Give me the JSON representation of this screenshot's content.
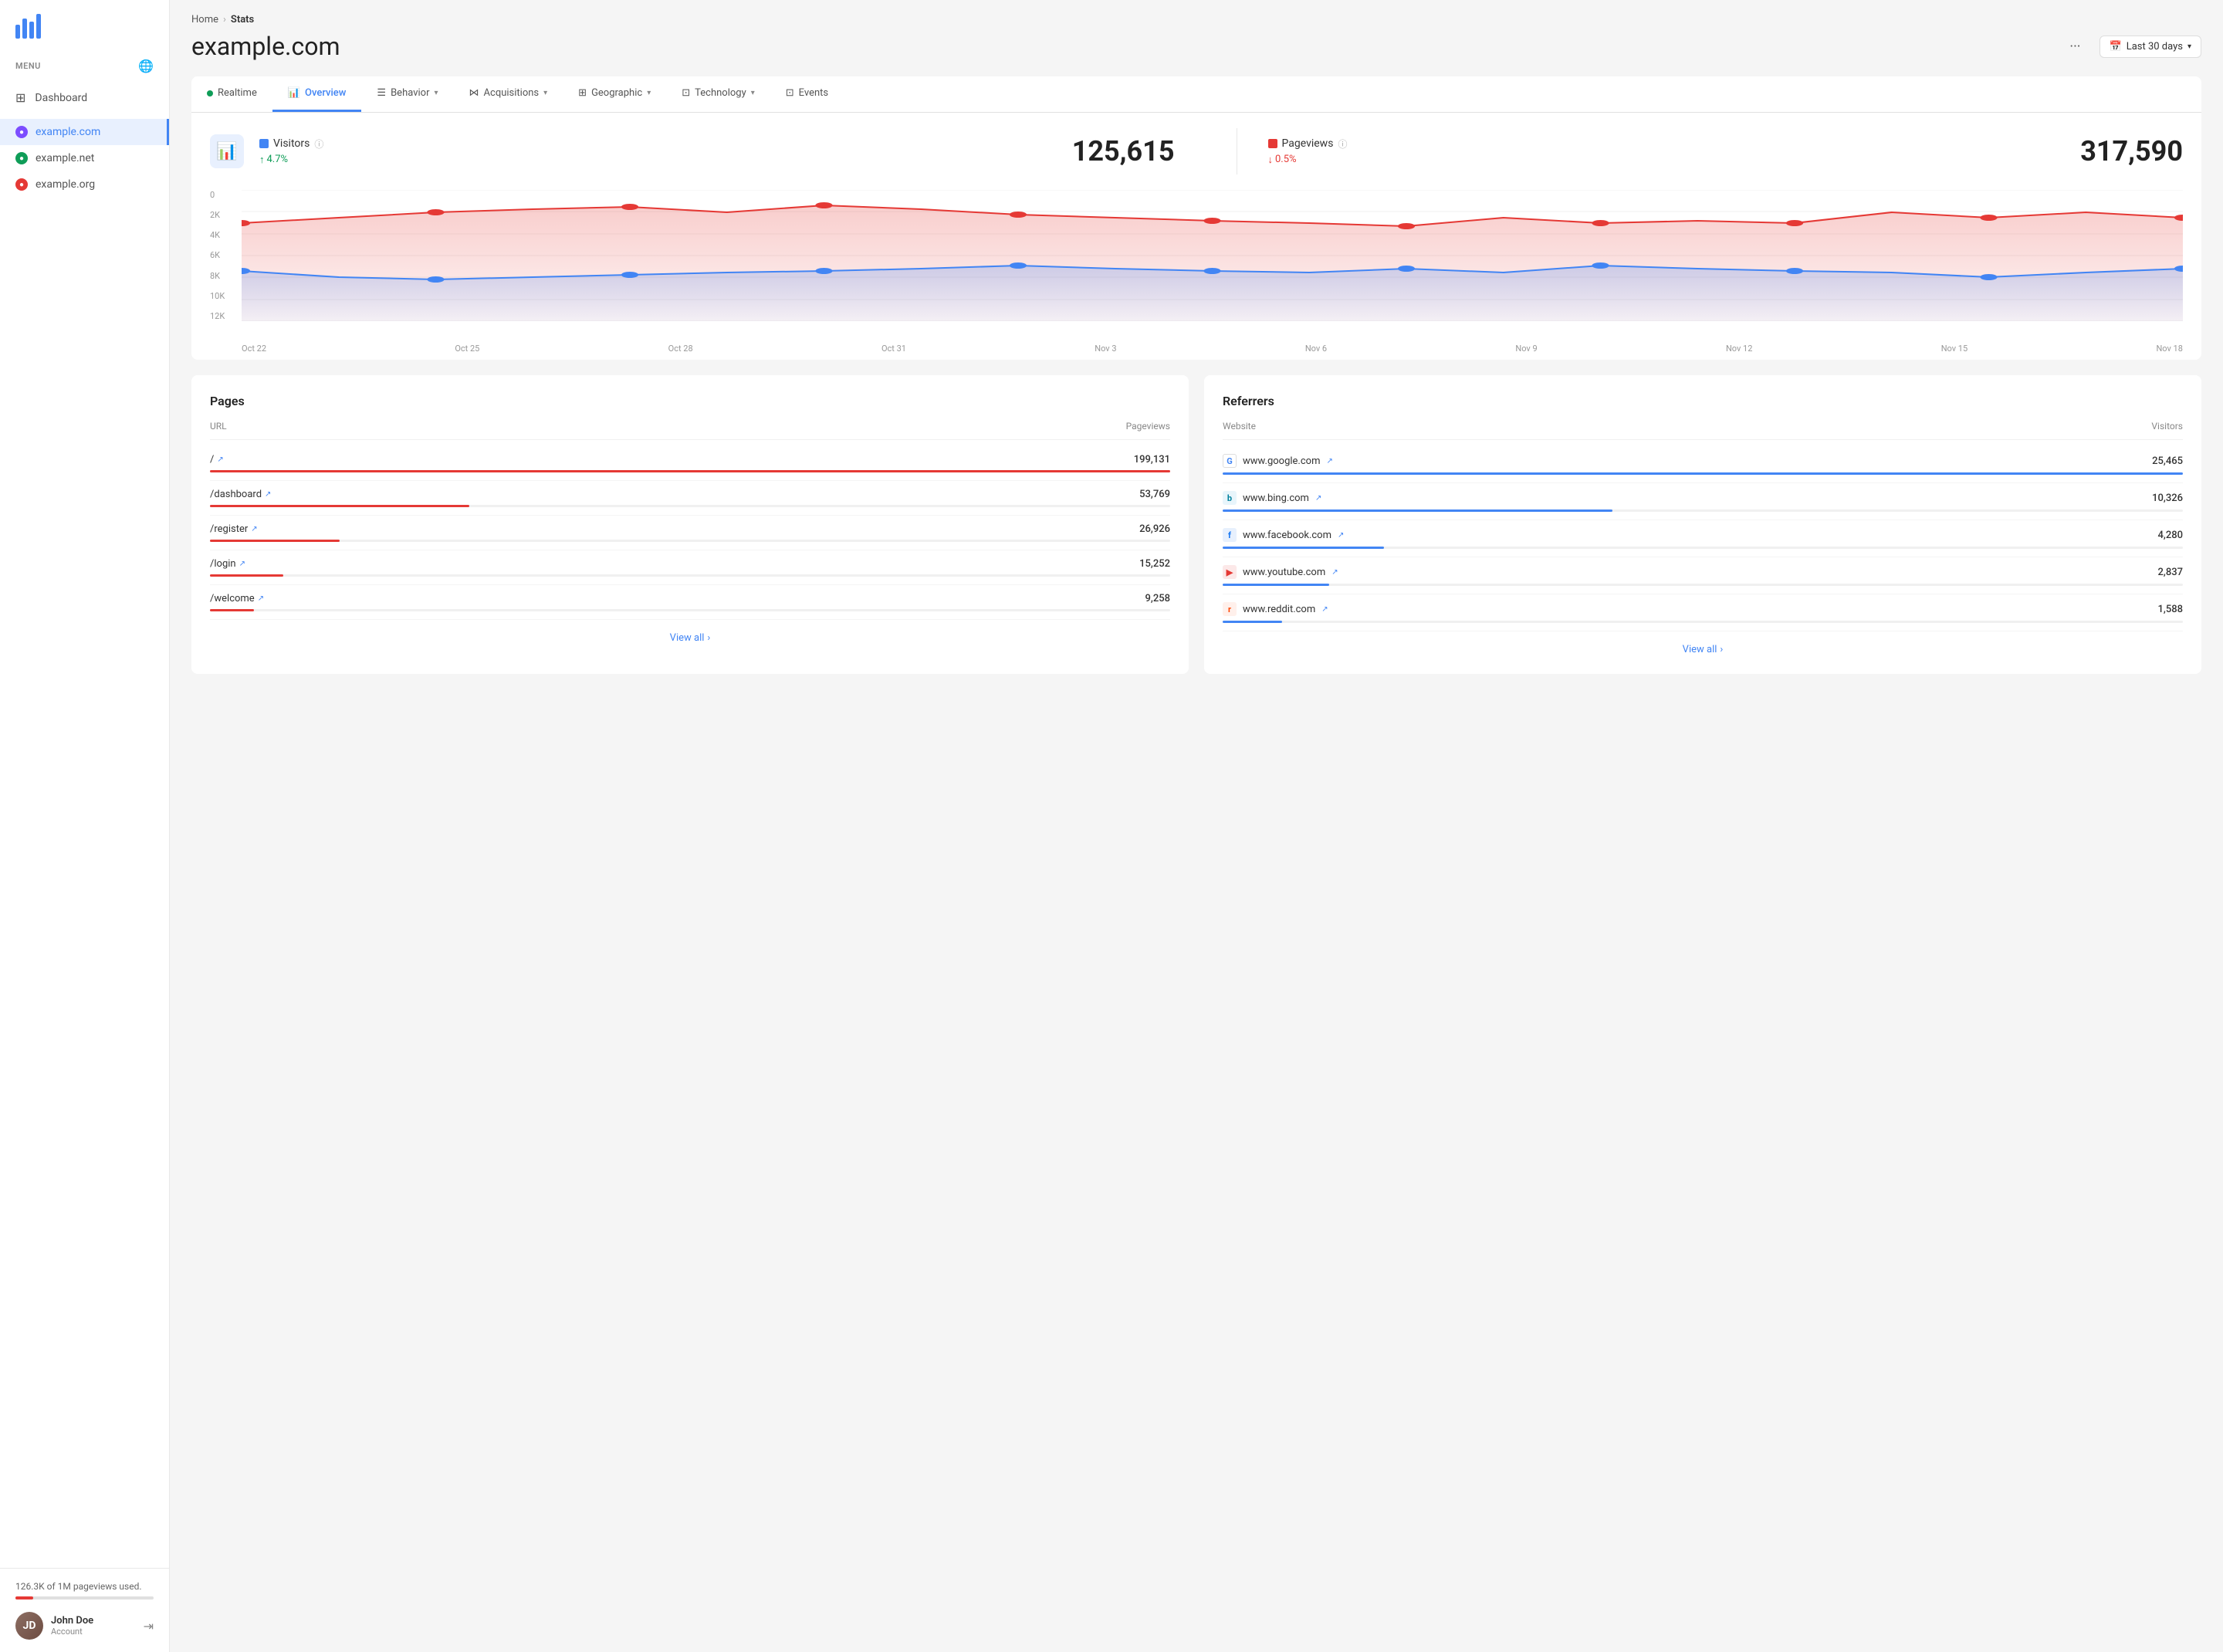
{
  "sidebar": {
    "menu_label": "MENU",
    "nav_items": [
      {
        "id": "dashboard",
        "label": "Dashboard",
        "icon": "⊞"
      }
    ],
    "sites": [
      {
        "id": "example-com",
        "label": "example.com",
        "color": "#7c4dff",
        "active": true
      },
      {
        "id": "example-net",
        "label": "example.net",
        "color": "#0f9d58",
        "active": false
      },
      {
        "id": "example-org",
        "label": "example.org",
        "color": "#e53935",
        "active": false
      }
    ],
    "usage_text": "126.3K of 1M pageviews used.",
    "usage_pct": 12.63,
    "user": {
      "name": "John Doe",
      "sub": "Account"
    }
  },
  "header": {
    "breadcrumb_home": "Home",
    "breadcrumb_current": "Stats",
    "title": "example.com",
    "more_icon": "···",
    "date_icon": "📅",
    "date_label": "Last 30 days"
  },
  "tabs": [
    {
      "id": "realtime",
      "label": "Realtime",
      "type": "dot"
    },
    {
      "id": "overview",
      "label": "Overview",
      "type": "icon",
      "active": true
    },
    {
      "id": "behavior",
      "label": "Behavior",
      "type": "chevron"
    },
    {
      "id": "acquisitions",
      "label": "Acquisitions",
      "type": "chevron"
    },
    {
      "id": "geographic",
      "label": "Geographic",
      "type": "chevron"
    },
    {
      "id": "technology",
      "label": "Technology",
      "type": "chevron"
    },
    {
      "id": "events",
      "label": "Events",
      "type": "icon"
    }
  ],
  "stats": {
    "visitors_label": "Visitors",
    "visitors_change": "4.7%",
    "visitors_change_dir": "up",
    "visitors_value": "125,615",
    "pageviews_label": "Pageviews",
    "pageviews_change": "0.5%",
    "pageviews_change_dir": "down",
    "pageviews_value": "317,590",
    "chart": {
      "y_labels": [
        "0",
        "2K",
        "4K",
        "6K",
        "8K",
        "10K",
        "12K"
      ],
      "dates": [
        "Oct 22",
        "Oct 25",
        "Oct 28",
        "Oct 31",
        "Nov 3",
        "Nov 6",
        "Nov 9",
        "Nov 12",
        "Nov 15",
        "Nov 18"
      ],
      "visitors_color": "#4285f4",
      "pageviews_color": "#e53935"
    }
  },
  "pages": {
    "title": "Pages",
    "col_url": "URL",
    "col_pageviews": "Pageviews",
    "rows": [
      {
        "url": "/",
        "value": "199,131",
        "pct": 100
      },
      {
        "url": "/dashboard",
        "value": "53,769",
        "pct": 27
      },
      {
        "url": "/register",
        "value": "26,926",
        "pct": 13.5
      },
      {
        "url": "/login",
        "value": "15,252",
        "pct": 7.6
      },
      {
        "url": "/welcome",
        "value": "9,258",
        "pct": 4.6
      }
    ],
    "view_all": "View all"
  },
  "referrers": {
    "title": "Referrers",
    "col_website": "Website",
    "col_visitors": "Visitors",
    "rows": [
      {
        "site": "www.google.com",
        "icon_label": "G",
        "icon_color": "#4285f4",
        "icon_bg": "#fff",
        "value": "25,465",
        "pct": 100
      },
      {
        "site": "www.bing.com",
        "icon_label": "b",
        "icon_color": "#00809d",
        "icon_bg": "#e8f5fb",
        "value": "10,326",
        "pct": 40.6
      },
      {
        "site": "www.facebook.com",
        "icon_label": "f",
        "icon_color": "#1877f2",
        "icon_bg": "#e7f0fd",
        "value": "4,280",
        "pct": 16.8
      },
      {
        "site": "www.youtube.com",
        "icon_label": "▶",
        "icon_color": "#e53935",
        "icon_bg": "#fce8e8",
        "value": "2,837",
        "pct": 11.1
      },
      {
        "site": "www.reddit.com",
        "icon_label": "r",
        "icon_color": "#ff4500",
        "icon_bg": "#fff0eb",
        "value": "1,588",
        "pct": 6.2
      }
    ],
    "view_all": "View all"
  }
}
